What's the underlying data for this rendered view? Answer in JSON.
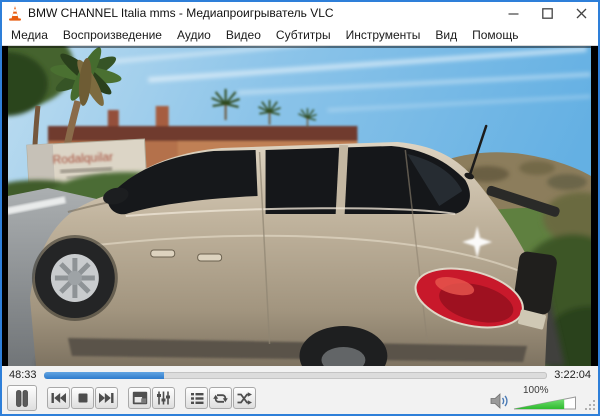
{
  "window": {
    "title": "BMW CHANNEL Italia mms - Медиапроигрыватель VLC",
    "app_icon": "vlc-cone"
  },
  "menu": {
    "items": [
      {
        "label": "Медиа"
      },
      {
        "label": "Воспроизведение"
      },
      {
        "label": "Аудио"
      },
      {
        "label": "Видео"
      },
      {
        "label": "Субтитры"
      },
      {
        "label": "Инструменты"
      },
      {
        "label": "Вид"
      },
      {
        "label": "Помощь"
      }
    ]
  },
  "video": {
    "description": "car driving on road past palm trees and building",
    "sign_line1": "Rodalquilar"
  },
  "seekbar": {
    "elapsed": "48:33",
    "total": "3:22:04",
    "progress_pct": 24
  },
  "toolbar": {
    "buttons": [
      "pause",
      "previous",
      "stop",
      "next",
      "fullscreen",
      "extended-settings",
      "playlist",
      "loop",
      "random"
    ]
  },
  "volume": {
    "percent_label": "100%",
    "level_pct": 80
  },
  "colors": {
    "accent_border": "#2e7fd9",
    "seek_fill": "#3f88d8",
    "volume_green": "#4ed34e",
    "titlebar_bg": "#ffffff",
    "toolbar_bg": "#f2f2f2"
  }
}
